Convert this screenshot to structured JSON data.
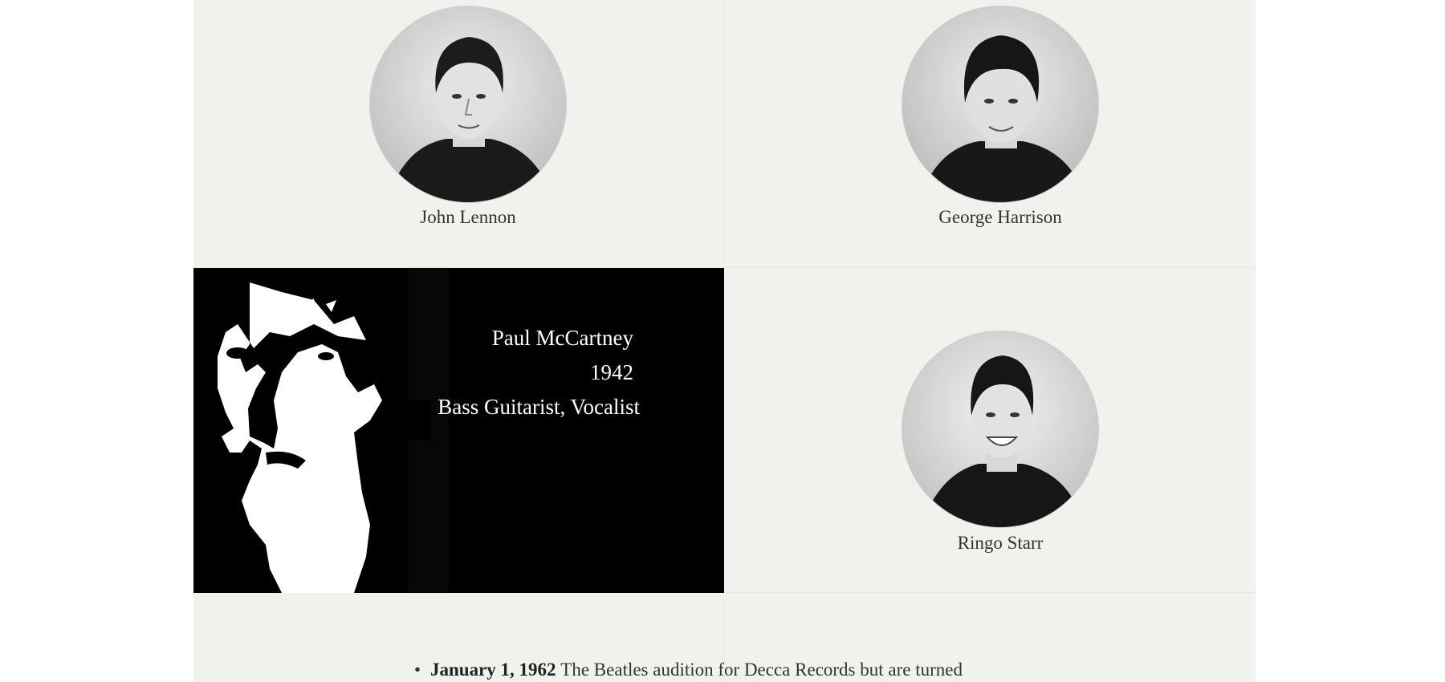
{
  "members": {
    "lennon": {
      "name": "John Lennon"
    },
    "harrison": {
      "name": "George Harrison"
    },
    "mccartney": {
      "name": "Paul McCartney",
      "year": "1942",
      "role": "Bass Guitarist, Vocalist"
    },
    "starr": {
      "name": "Ringo Starr"
    }
  },
  "timeline": {
    "items": [
      {
        "date": "January 1, 1962",
        "text": "The Beatles audition for Decca Records but are turned"
      }
    ]
  },
  "colors": {
    "background": "#f1f1ed",
    "text": "#333333",
    "feature_bg": "#000000",
    "feature_text": "#ffffff"
  }
}
